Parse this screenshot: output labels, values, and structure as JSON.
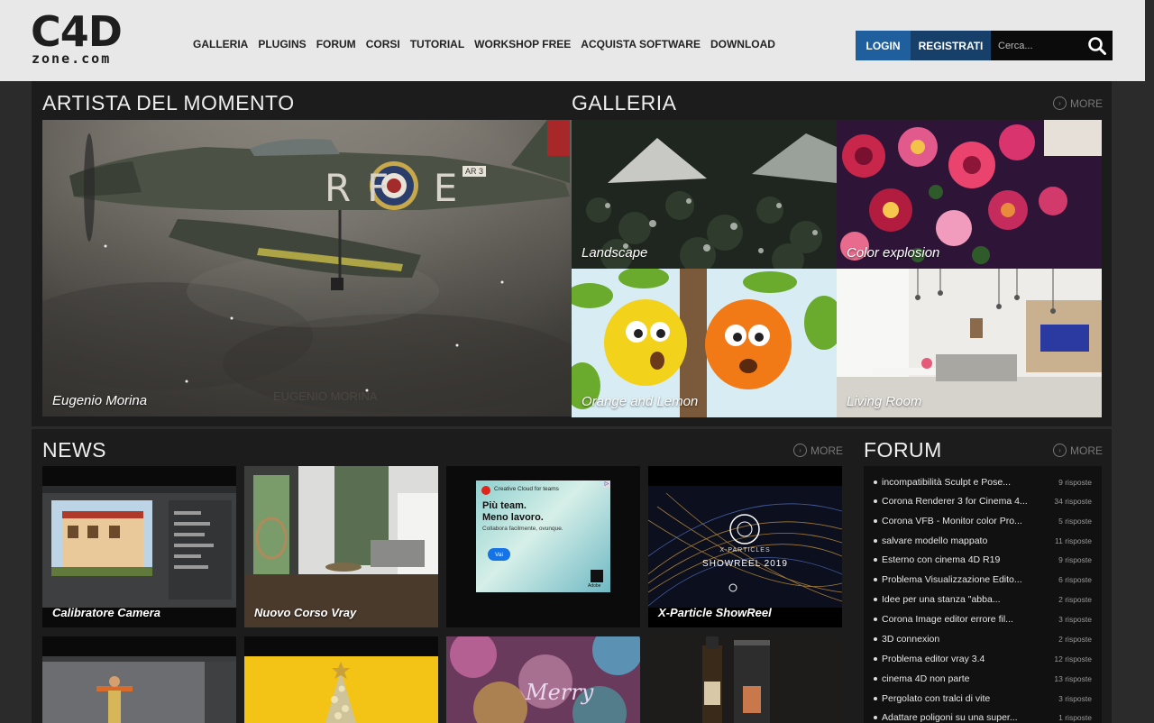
{
  "header": {
    "logo_big": "C4D",
    "logo_small": "zone.com",
    "nav": [
      "GALLERIA",
      "PLUGINS",
      "FORUM",
      "CORSI",
      "TUTORIAL",
      "WORKSHOP FREE",
      "ACQUISTA SOFTWARE",
      "DOWNLOAD"
    ],
    "login_label": "LOGIN",
    "register_label": "REGISTRATI",
    "search_placeholder": "Cerca..."
  },
  "artist": {
    "title": "ARTISTA DEL MOMENTO",
    "caption": "Eugenio Morina",
    "watermark": "EUGENIO  MORINA",
    "plane_marking": "RF  E",
    "plane_code": "AR 3"
  },
  "gallery": {
    "title": "GALLERIA",
    "more": "MORE",
    "items": [
      "Landscape",
      "Color explosion",
      "Orange and Lemon",
      "Living Room"
    ]
  },
  "news": {
    "title": "NEWS",
    "more": "MORE",
    "items": [
      "Calibratore Camera",
      "Nuovo Corso Vray",
      "",
      "X-Particle ShowReel"
    ],
    "ad": {
      "brand": "Creative Cloud for teams",
      "headline_1": "Più team.",
      "headline_2": "Meno lavoro.",
      "sub": "Collabora facilmente, ovunque.",
      "cta": "Vai",
      "logo": "Adobe"
    },
    "xp_logo": "X-PARTICLES",
    "xp_sub": "SHOWREEL 2019",
    "merry": "Merry"
  },
  "forum": {
    "title": "FORUM",
    "more": "MORE",
    "topics": [
      {
        "title": "incompatibilità Sculpt e Pose...",
        "replies": "9 risposte"
      },
      {
        "title": "Corona Renderer 3 for Cinema 4...",
        "replies": "34 risposte"
      },
      {
        "title": "Corona VFB - Monitor color Pro...",
        "replies": "5 risposte"
      },
      {
        "title": "salvare modello mappato",
        "replies": "11 risposte"
      },
      {
        "title": "Esterno con cinema 4D R19",
        "replies": "9 risposte"
      },
      {
        "title": "Problema Visualizzazione Edito...",
        "replies": "6 risposte"
      },
      {
        "title": "Idee per una stanza \"abba...",
        "replies": "2 risposte"
      },
      {
        "title": "Corona Image editor errore fil...",
        "replies": "3 risposte"
      },
      {
        "title": "3D connexion",
        "replies": "2 risposte"
      },
      {
        "title": "Problema editor vray 3.4",
        "replies": "12 risposte"
      },
      {
        "title": "cinema 4D non parte",
        "replies": "13 risposte"
      },
      {
        "title": "Pergolato con tralci di vite",
        "replies": "3 risposte"
      },
      {
        "title": "Adattare poligoni su una super...",
        "replies": "1 risposte"
      }
    ]
  }
}
